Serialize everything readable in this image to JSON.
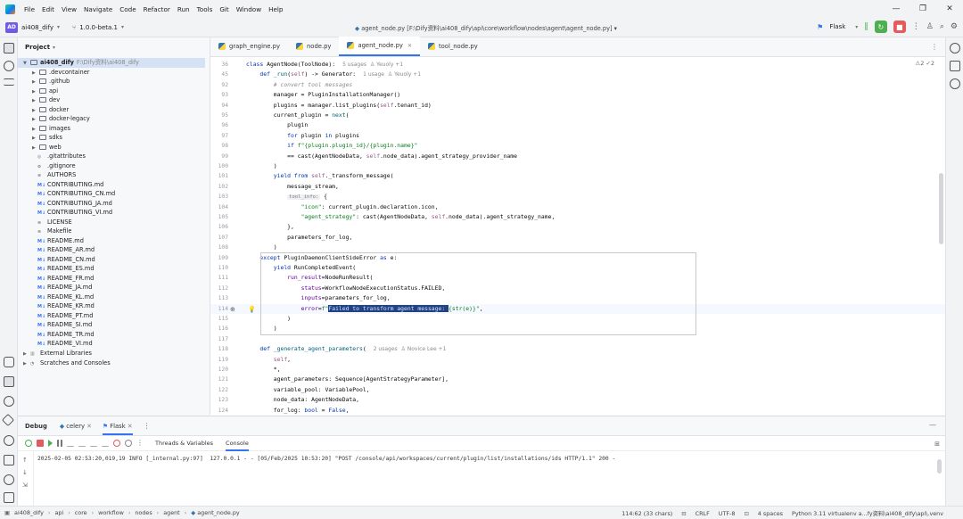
{
  "menubar": {
    "items": [
      "File",
      "Edit",
      "View",
      "Navigate",
      "Code",
      "Refactor",
      "Run",
      "Tools",
      "Git",
      "Window",
      "Help"
    ],
    "window_controls": [
      "—",
      "❐",
      "✕"
    ]
  },
  "toolbar": {
    "project_badge": "AD",
    "project_name": "ai408_dify",
    "branch": "1.0.0-beta.1",
    "file_path": "agent_node.py [F:\\Dify资料\\ai408_dify\\api\\core\\workflow\\nodes\\agent\\agent_node.py]",
    "run_config": "Flask"
  },
  "project_panel": {
    "title": "Project",
    "root_name": "ai408_dify",
    "root_path": "F:\\Dify资料\\ai408_dify",
    "folders": [
      ".devcontainer",
      ".github",
      "api",
      "dev",
      "docker",
      "docker-legacy",
      "images",
      "sdks",
      "web"
    ],
    "files": [
      {
        "name": ".gitattributes",
        "icon": "◎"
      },
      {
        "name": ".gitignore",
        "icon": "⊘"
      },
      {
        "name": "AUTHORS",
        "icon": "≡"
      },
      {
        "name": "CONTRIBUTING.md",
        "icon": "M↓"
      },
      {
        "name": "CONTRIBUTING_CN.md",
        "icon": "M↓"
      },
      {
        "name": "CONTRIBUTING_JA.md",
        "icon": "M↓"
      },
      {
        "name": "CONTRIBUTING_VI.md",
        "icon": "M↓"
      },
      {
        "name": "LICENSE",
        "icon": "≡"
      },
      {
        "name": "Makefile",
        "icon": "≡"
      },
      {
        "name": "README.md",
        "icon": "M↓"
      },
      {
        "name": "README_AR.md",
        "icon": "M↓"
      },
      {
        "name": "README_CN.md",
        "icon": "M↓"
      },
      {
        "name": "README_ES.md",
        "icon": "M↓"
      },
      {
        "name": "README_FR.md",
        "icon": "M↓"
      },
      {
        "name": "README_JA.md",
        "icon": "M↓"
      },
      {
        "name": "README_KL.md",
        "icon": "M↓"
      },
      {
        "name": "README_KR.md",
        "icon": "M↓"
      },
      {
        "name": "README_PT.md",
        "icon": "M↓"
      },
      {
        "name": "README_SI.md",
        "icon": "M↓"
      },
      {
        "name": "README_TR.md",
        "icon": "M↓"
      },
      {
        "name": "README_VI.md",
        "icon": "M↓"
      }
    ],
    "external_libraries": "External Libraries",
    "scratches": "Scratches and Consoles"
  },
  "editor_tabs": [
    {
      "label": "graph_engine.py",
      "active": false
    },
    {
      "label": "node.py",
      "active": false
    },
    {
      "label": "agent_node.py",
      "active": true
    },
    {
      "label": "tool_node.py",
      "active": false
    }
  ],
  "editor": {
    "warnings": "⚠2 ✓2",
    "lines": [
      {
        "n": "36",
        "html": "<span class='kw'>class</span> AgentNode(ToolNode):<span class='hint'>5 usages  ♙ Yeuoly +1</span>"
      },
      {
        "n": "45",
        "html": "    <span class='kw'>def</span> <span class='fn'>_run</span>(<span class='se'>self</span>) -> Generator:<span class='hint'>1 usage  ♙ Yeuoly +1</span>"
      },
      {
        "n": "92",
        "html": "        <span class='cm'># convert tool messages</span>"
      },
      {
        "n": "93",
        "html": "        manager = PluginInstallationManager()"
      },
      {
        "n": "94",
        "html": "        plugins = manager.list_plugins(<span class='se'>self</span>.tenant_id)"
      },
      {
        "n": "95",
        "html": "        current_plugin = <span class='fn'>next</span>("
      },
      {
        "n": "96",
        "html": "            plugin"
      },
      {
        "n": "97",
        "html": "            <span class='kw'>for</span> plugin <span class='kw'>in</span> plugins"
      },
      {
        "n": "98",
        "html": "            <span class='kw'>if</span> <span class='st'>f\"{plugin.plugin_id}/{plugin.name}\"</span>"
      },
      {
        "n": "99",
        "html": "            == cast(AgentNodeData, <span class='se'>self</span>.node_data).agent_strategy_provider_name"
      },
      {
        "n": "100",
        "html": "        )"
      },
      {
        "n": "101",
        "html": "        <span class='kw'>yield from</span> <span class='se'>self</span>._transform_message("
      },
      {
        "n": "102",
        "html": "            message_stream,"
      },
      {
        "n": "103",
        "html": "            <span class='inlay'>tool_info:</span> {"
      },
      {
        "n": "104",
        "html": "                <span class='st'>\"icon\"</span>: current_plugin.declaration.icon,"
      },
      {
        "n": "105",
        "html": "                <span class='st'>\"agent_strategy\"</span>: cast(AgentNodeData, <span class='se'>self</span>.node_data).agent_strategy_name,"
      },
      {
        "n": "106",
        "html": "            },"
      },
      {
        "n": "107",
        "html": "            parameters_for_log,"
      },
      {
        "n": "108",
        "html": "        )"
      },
      {
        "n": "109",
        "html": "    <span class='kw'>except</span> PluginDaemonClientSideError <span class='kw'>as</span> e:"
      },
      {
        "n": "110",
        "html": "        <span class='kw'>yield</span> RunCompletedEvent("
      },
      {
        "n": "111",
        "html": "            <span class='pr'>run_result</span>=NodeRunResult("
      },
      {
        "n": "112",
        "html": "                <span class='pr'>status</span>=WorkflowNodeExecutionStatus.FAILED,"
      },
      {
        "n": "113",
        "html": "                <span class='pr'>inputs</span>=parameters_for_log,"
      },
      {
        "n": "114",
        "html": "                <span class='pr'>error</span>=<span class='st'>f\"<span class='sel'>Failed to transform agent message: </span>{str(e)}\"</span>,"
      },
      {
        "n": "115",
        "html": "            )"
      },
      {
        "n": "116",
        "html": "        )"
      },
      {
        "n": "117",
        "html": ""
      },
      {
        "n": "118",
        "html": "    <span class='kw'>def</span> <span class='fn'>_generate_agent_parameters</span>(<span class='hint'>2 usages  ♙ Novice Lee +1</span>"
      },
      {
        "n": "119",
        "html": "        <span class='se'>self</span>,"
      },
      {
        "n": "120",
        "html": "        *,"
      },
      {
        "n": "121",
        "html": "        agent_parameters: Sequence[AgentStrategyParameter],"
      },
      {
        "n": "122",
        "html": "        variable_pool: VariablePool,"
      },
      {
        "n": "123",
        "html": "        node_data: AgentNodeData,"
      },
      {
        "n": "124",
        "html": "        for_log: <span class='kw'>bool</span> = <span class='kw'>False</span>,"
      }
    ]
  },
  "debug_panel": {
    "title": "Debug",
    "tabs": [
      "celery",
      "Flask"
    ],
    "subtabs": [
      "Threads & Variables",
      "Console"
    ],
    "console_line": "2025-02-05 02:53:20,019,19 INFO [_internal.py:97]  127.0.0.1 - - [05/Feb/2025 10:53:20] \"POST /console/api/workspaces/current/plugin/list/installations/ids HTTP/1.1\" 200 -"
  },
  "statusbar": {
    "crumbs": [
      "ai408_dify",
      "api",
      "core",
      "workflow",
      "nodes",
      "agent",
      "agent_node.py"
    ],
    "position": "114:62 (33 chars)",
    "line_sep": "CRLF",
    "encoding": "UTF-8",
    "indent": "4 spaces",
    "interpreter": "Python 3.11 virtualenv a...fy资料\\ai408_dify\\api\\.venv"
  },
  "colors": {
    "accent": "#3574f0",
    "selection": "#214283",
    "run_green": "#4caf50",
    "stop_red": "#e55b5b"
  }
}
